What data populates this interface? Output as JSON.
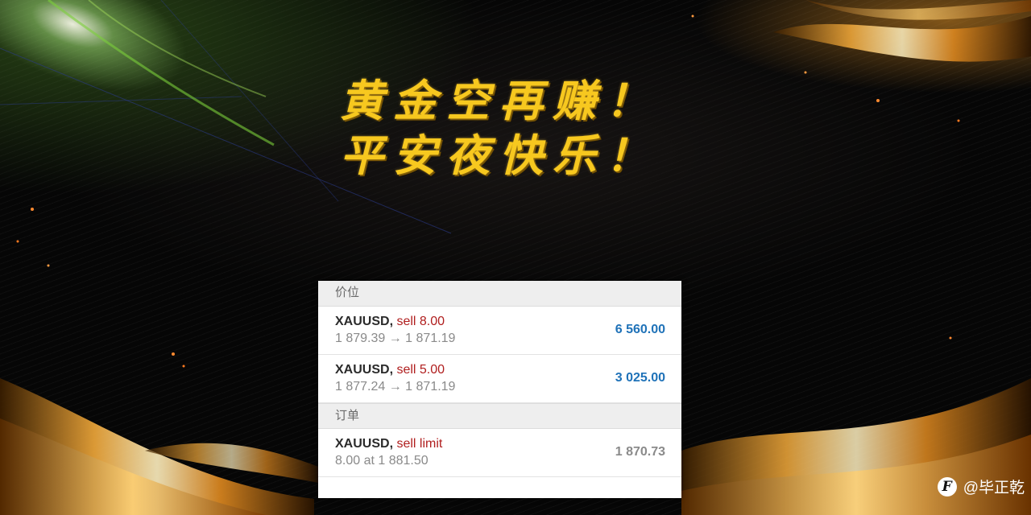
{
  "headline": {
    "line1": "黄金空再赚！",
    "line2": "平安夜快乐！"
  },
  "positions_section": {
    "title": "价位"
  },
  "positions": [
    {
      "symbol": "XAUUSD",
      "side": "sell 8.00",
      "prices": "1 879.39 → 1 871.19",
      "profit": "6 560.00"
    },
    {
      "symbol": "XAUUSD",
      "side": "sell 5.00",
      "prices": "1 877.24 → 1 871.19",
      "profit": "3 025.00"
    }
  ],
  "orders_section": {
    "title": "订单"
  },
  "orders": [
    {
      "symbol": "XAUUSD",
      "side": "sell limit",
      "detail": "8.00 at 1 881.50",
      "current_price": "1 870.73"
    }
  ],
  "watermark": {
    "logo_icon": "fang-logo-icon",
    "handle": "@毕正乾"
  },
  "colors": {
    "headline": "#f7c81f",
    "sell": "#b01e1e",
    "profit": "#1f72b8",
    "pending": "#8a8a8a"
  }
}
